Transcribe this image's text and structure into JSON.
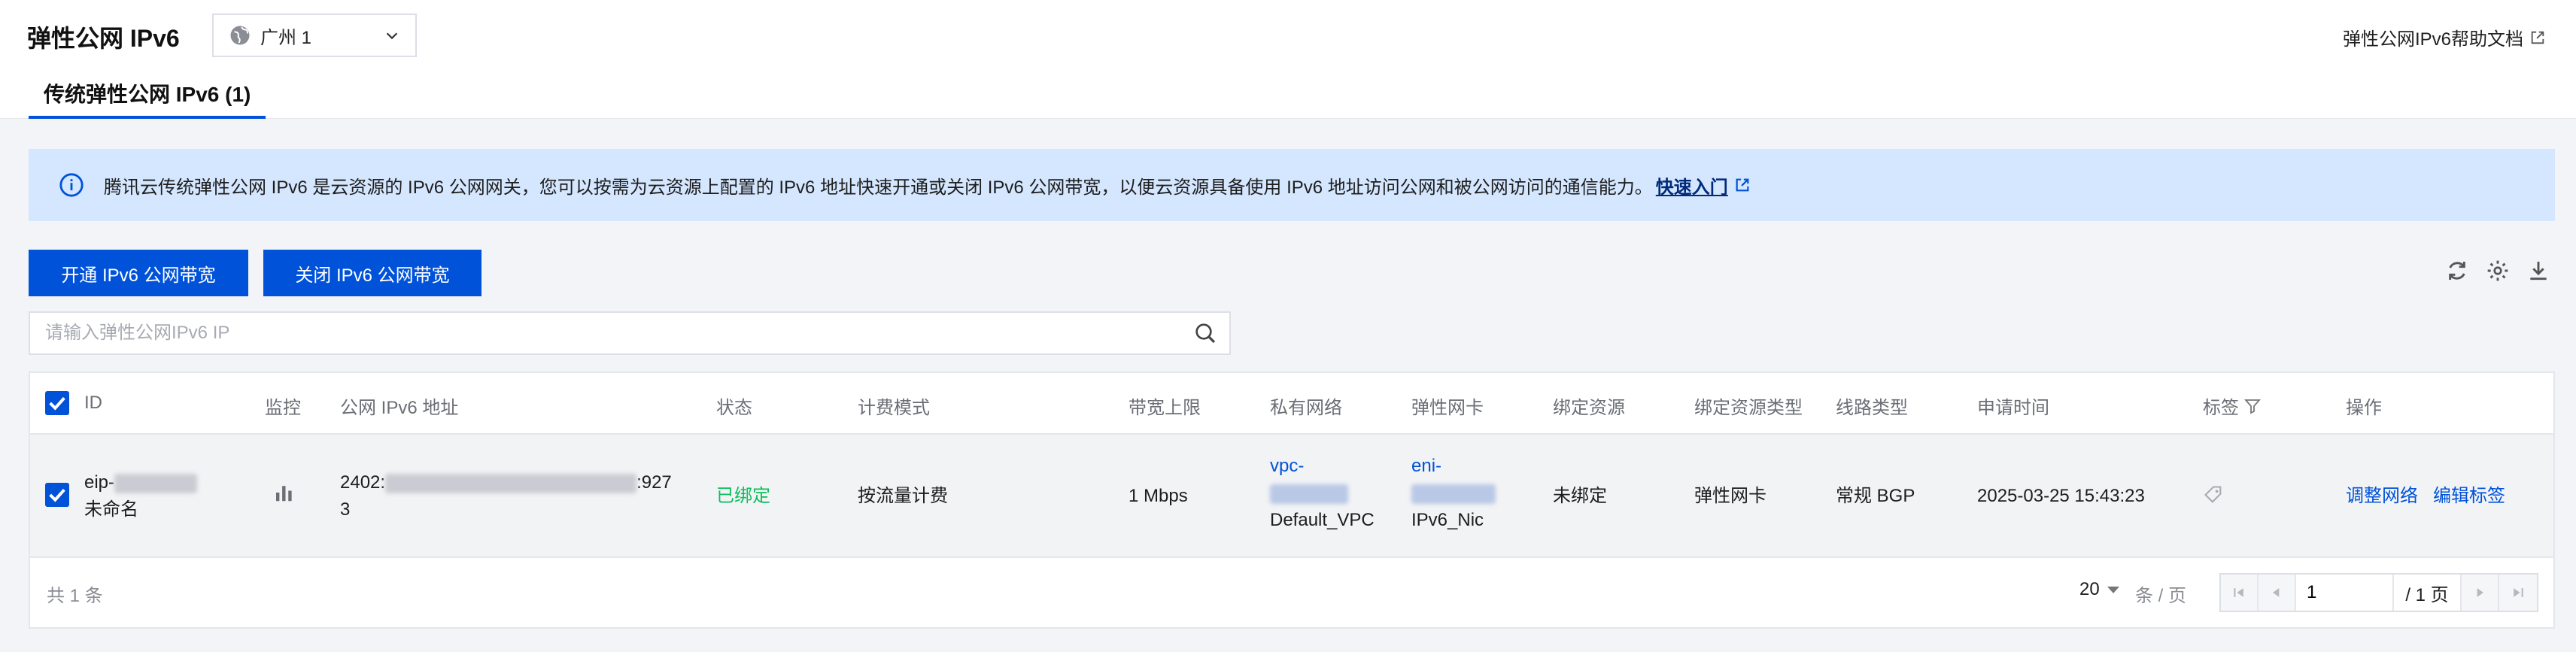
{
  "header": {
    "title": "弹性公网 IPv6",
    "region": "广州 1",
    "help_link": "弹性公网IPv6帮助文档",
    "tab": "传统弹性公网 IPv6 (1)"
  },
  "notice": {
    "text": "腾讯云传统弹性公网 IPv6 是云资源的 IPv6 公网网关，您可以按需为云资源上配置的 IPv6 地址快速开通或关闭 IPv6 公网带宽，以便云资源具备使用 IPv6 地址访问公网和被公网访问的通信能力。",
    "link": "快速入门"
  },
  "toolbar": {
    "open_label": "开通 IPv6 公网带宽",
    "close_label": "关闭 IPv6 公网带宽"
  },
  "search": {
    "placeholder": "请输入弹性公网IPv6 IP"
  },
  "table": {
    "columns": [
      "ID",
      "监控",
      "公网 IPv6 地址",
      "状态",
      "计费模式",
      "带宽上限",
      "私有网络",
      "弹性网卡",
      "绑定资源",
      "绑定资源类型",
      "线路类型",
      "申请时间",
      "标签",
      "操作"
    ],
    "row": {
      "id_prefix": "eip-",
      "name": "未命名",
      "ipv6_prefix": "2402:",
      "ipv6_suffix_1": ":927",
      "ipv6_suffix_2": "3",
      "status": "已绑定",
      "billing": "按流量计费",
      "bandwidth": "1 Mbps",
      "vpc_prefix": "vpc-",
      "vpc_name": "Default_VPC",
      "eni_prefix": "eni-",
      "eni_name": "IPv6_Nic",
      "bound_resource": "未绑定",
      "resource_type": "弹性网卡",
      "line_type": "常规 BGP",
      "created_at": "2025-03-25 15:43:23",
      "action_adjust": "调整网络",
      "action_tag": "编辑标签"
    }
  },
  "footer": {
    "total": "共 1 条",
    "page_size": "20",
    "page_size_unit": "条 / 页",
    "page_input": "1",
    "page_total": "/ 1 页"
  },
  "colors": {
    "primary": "#0052d9",
    "notice_bg": "#d5e7ff",
    "status_green": "#0abf5b"
  }
}
